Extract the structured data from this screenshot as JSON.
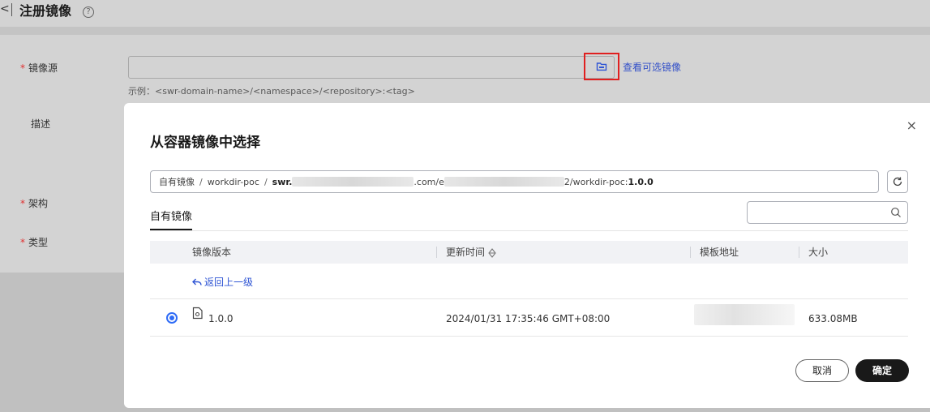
{
  "page": {
    "back_glyph": "<",
    "title": "注册镜像",
    "help_glyph": "?"
  },
  "form": {
    "source_label": "镜像源",
    "required_mark": "*",
    "view_link": "查看可选镜像",
    "example": "示例：<swr-domain-name>/<namespace>/<repository>:<tag>",
    "description_label": "描述",
    "arch_label": "架构",
    "type_label": "类型"
  },
  "modal": {
    "title": "从容器镜像中选择",
    "close_glyph": "×",
    "breadcrumb": {
      "item1": "自有镜像",
      "separator": "/",
      "item2": "workdir-poc",
      "item3_prefix": "swr.",
      "item3_mid": ".com/e",
      "item3_suffix": "2/workdir-poc:",
      "item3_tag": "1.0.0"
    },
    "tab": "自有镜像",
    "search_placeholder": "",
    "table": {
      "headers": [
        "镜像版本",
        "更新时间",
        "模板地址",
        "大小"
      ],
      "back_link": "返回上一级",
      "rows": [
        {
          "version": "1.0.0",
          "updated": "2024/01/31 17:35:46 GMT+08:00",
          "size": "633.08MB",
          "selected": true
        }
      ]
    },
    "cancel": "取消",
    "confirm": "确定"
  },
  "colors": {
    "accent": "#2f6cf6",
    "link": "#3350c8",
    "highlight_border": "#e02020",
    "primary_button": "#191919"
  }
}
